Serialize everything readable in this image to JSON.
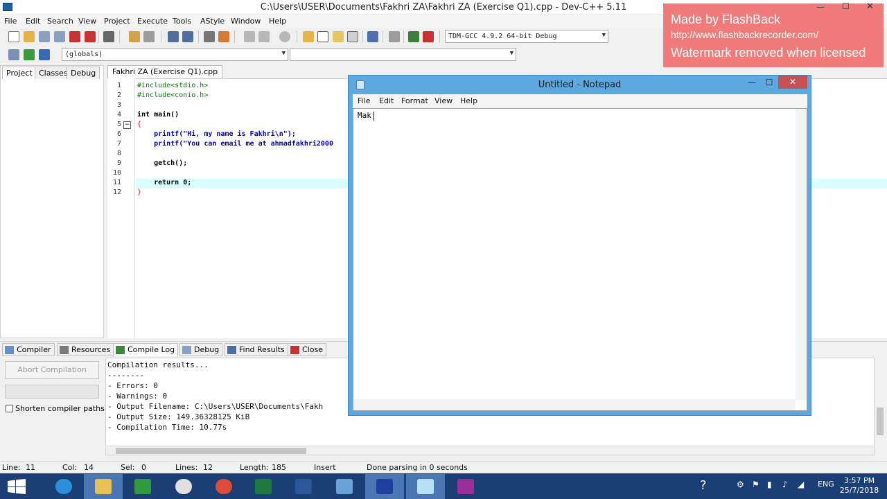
{
  "devcpp": {
    "title": "C:\\Users\\USER\\Documents\\Fakhri ZA\\Fakhri ZA (Exercise Q1).cpp - Dev-C++ 5.11",
    "menu": [
      "File",
      "Edit",
      "Search",
      "View",
      "Project",
      "Execute",
      "Tools",
      "AStyle",
      "Window",
      "Help"
    ],
    "compiler_combo": "TDM-GCC 4.9.2 64-bit Debug",
    "globals_combo": "(globals)",
    "left_tabs": [
      "Project",
      "Classes",
      "Debug"
    ],
    "editor_tab": "Fakhri ZA (Exercise Q1).cpp",
    "code_lines": [
      {
        "n": "1",
        "text": "#include<stdio.h>"
      },
      {
        "n": "2",
        "text": "#include<conio.h>"
      },
      {
        "n": "3",
        "text": ""
      },
      {
        "n": "4",
        "text": "int main()"
      },
      {
        "n": "5",
        "text": "{"
      },
      {
        "n": "6",
        "text": "    printf(\"Hi, my name is Fakhri\\n\");"
      },
      {
        "n": "7",
        "text": "    printf(\"You can email me at ahmadfakhri2000"
      },
      {
        "n": "8",
        "text": ""
      },
      {
        "n": "9",
        "text": "    getch();"
      },
      {
        "n": "10",
        "text": ""
      },
      {
        "n": "11",
        "text": "    return 0;"
      },
      {
        "n": "12",
        "text": "}"
      }
    ],
    "fold_marker": "−",
    "bottom_tabs": [
      "Compiler",
      "Resources",
      "Compile Log",
      "Debug",
      "Find Results",
      "Close"
    ],
    "abort_label": "Abort Compilation",
    "shorten_label": "Shorten compiler paths",
    "log_lines": [
      "Compilation results...",
      "--------",
      "- Errors: 0",
      "- Warnings: 0",
      "- Output Filename: C:\\Users\\USER\\Documents\\Fakh",
      "- Output Size: 149.36328125 KiB",
      "- Compilation Time: 10.77s"
    ],
    "status": {
      "line_label": "Line:",
      "line_value": "11",
      "col_label": "Col:",
      "col_value": "14",
      "sel_label": "Sel:",
      "sel_value": "0",
      "lines_label": "Lines:",
      "lines_value": "12",
      "length_label": "Length:",
      "length_value": "185",
      "mode": "Insert",
      "message": "Done parsing in 0 seconds"
    }
  },
  "notepad": {
    "title": "Untitled - Notepad",
    "menu": [
      "File",
      "Edit",
      "Format",
      "View",
      "Help"
    ],
    "text": "Mak",
    "close_glyph": "✕",
    "min_glyph": "—",
    "max_glyph": "☐"
  },
  "watermark": {
    "line1": "Made by FlashBack",
    "line2": "http://www.flashbackrecorder.com/",
    "line3": "Watermark removed when licensed"
  },
  "taskbar": {
    "lang": "ENG",
    "time": "3:57 PM",
    "date": "25/7/2018"
  },
  "colors": {
    "code_directive": "#008000",
    "code_string": "#0000ff",
    "code_number": "#ff0000",
    "current_line": "#d9ffff",
    "notepad_frame": "#5ea8e0",
    "taskbar": "#1b3f74",
    "watermark": "#f17a7a"
  }
}
